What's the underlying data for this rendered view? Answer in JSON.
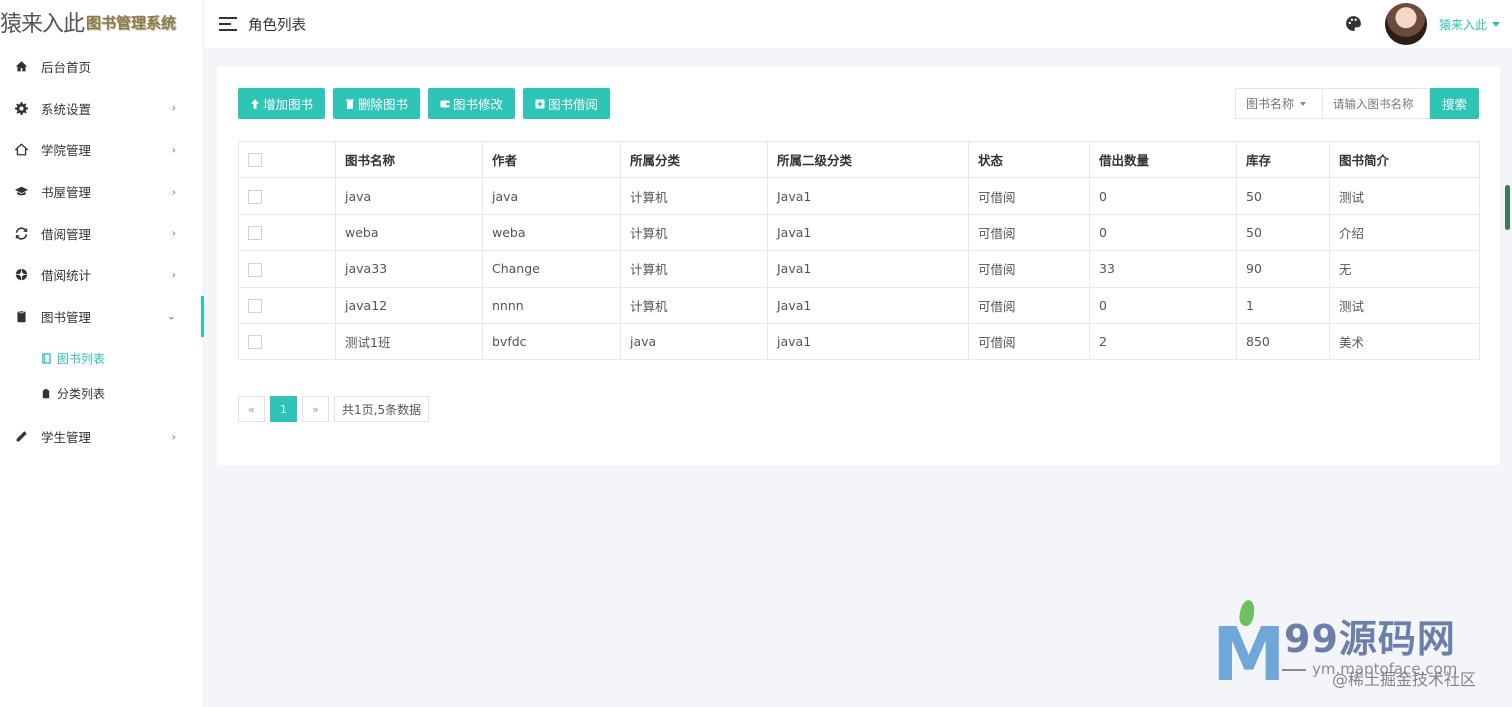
{
  "logo": {
    "main": "猿来入此",
    "sub": "图书管理系统"
  },
  "sidebar": {
    "items": [
      {
        "label": "后台首页",
        "icon": "home-icon",
        "has_children": false
      },
      {
        "label": "系统设置",
        "icon": "gear-icon",
        "has_children": true
      },
      {
        "label": "学院管理",
        "icon": "house-outline-icon",
        "has_children": true
      },
      {
        "label": "书屋管理",
        "icon": "graduation-cap-icon",
        "has_children": true
      },
      {
        "label": "借阅管理",
        "icon": "refresh-icon",
        "has_children": true
      },
      {
        "label": "借阅统计",
        "icon": "aperture-icon",
        "has_children": true
      },
      {
        "label": "图书管理",
        "icon": "clipboard-icon",
        "has_children": true,
        "expanded": true
      },
      {
        "label": "学生管理",
        "icon": "pencil-icon",
        "has_children": true
      }
    ],
    "sub_items": [
      {
        "label": "图书列表",
        "icon": "book-icon",
        "active": true
      },
      {
        "label": "分类列表",
        "icon": "clipboard-icon",
        "active": false
      }
    ]
  },
  "header": {
    "page_title": "角色列表",
    "username": "猿来入此"
  },
  "toolbar": {
    "add_label": "增加图书",
    "delete_label": "删除图书",
    "edit_label": "图书修改",
    "borrow_label": "图书借阅"
  },
  "search": {
    "field_selected": "图书名称",
    "placeholder": "请输入图书名称",
    "button_label": "搜索"
  },
  "table": {
    "columns": [
      "图书名称",
      "作者",
      "所属分类",
      "所属二级分类",
      "状态",
      "借出数量",
      "库存",
      "图书简介"
    ],
    "rows": [
      [
        "java",
        "java",
        "计算机",
        "Java1",
        "可借阅",
        "0",
        "50",
        "测试"
      ],
      [
        "weba",
        "weba",
        "计算机",
        "Java1",
        "可借阅",
        "0",
        "50",
        "介绍"
      ],
      [
        "java33",
        "Change",
        "计算机",
        "Java1",
        "可借阅",
        "33",
        "90",
        "无"
      ],
      [
        "java12",
        "nnnn",
        "计算机",
        "Java1",
        "可借阅",
        "0",
        "1",
        "测试"
      ],
      [
        "测试1班",
        "bvfdc",
        "java",
        "java1",
        "可借阅",
        "2",
        "850",
        "美术"
      ]
    ]
  },
  "pagination": {
    "prev": "«",
    "current_page": "1",
    "next": "»",
    "info": "共1页,5条数据"
  },
  "watermark": {
    "title": "99源码网",
    "url": "ym.maptoface.com",
    "note": "@稀土掘金技术社区"
  },
  "colors": {
    "accent": "#2ec4b6",
    "background": "#f4f5f9"
  }
}
